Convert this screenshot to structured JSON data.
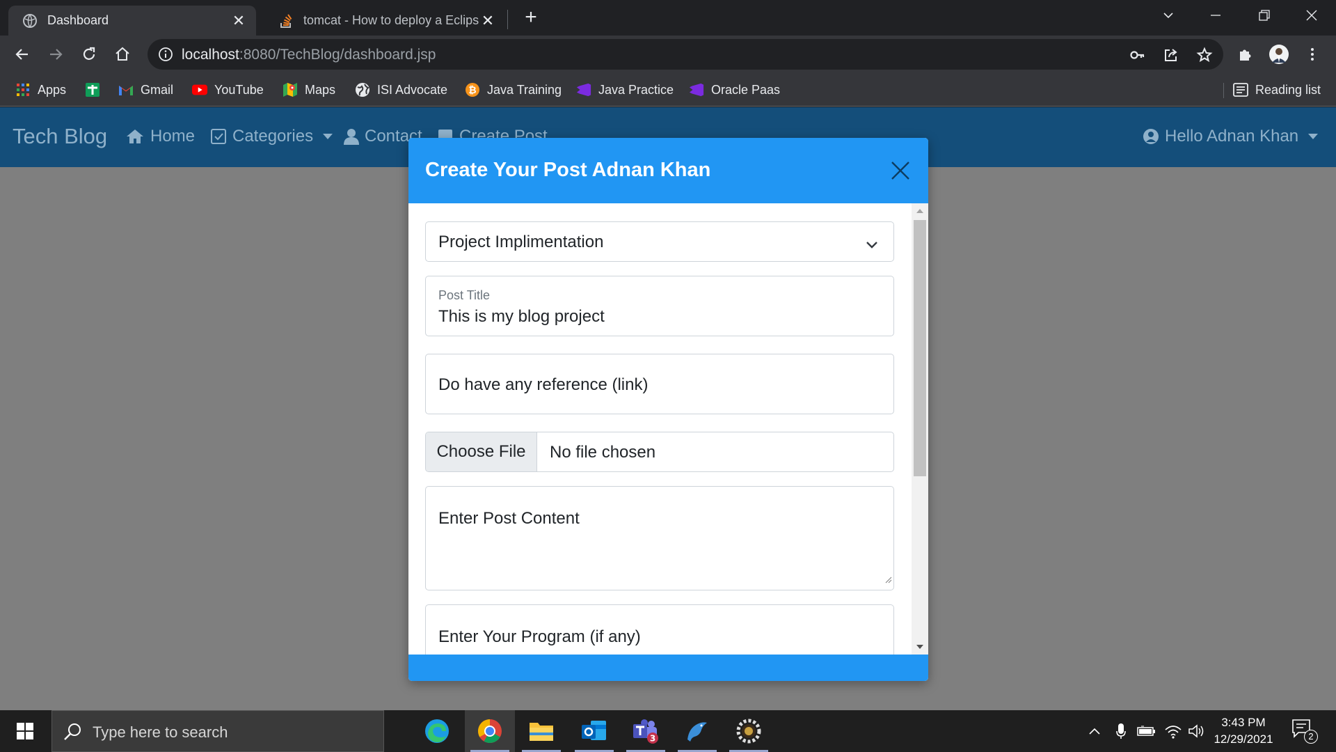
{
  "browser": {
    "tabs": [
      {
        "title": "Dashboard",
        "icon": "globe-icon",
        "active": true
      },
      {
        "title": "tomcat - How to deploy a Eclipse",
        "icon": "stackoverflow-icon",
        "active": false
      }
    ],
    "address": {
      "host": "localhost",
      "path": ":8080/TechBlog/dashboard.jsp"
    },
    "bookmarks": [
      {
        "label": "Apps",
        "icon": "apps-grid-icon"
      },
      {
        "label": "",
        "icon": "plus-square-icon"
      },
      {
        "label": "Gmail",
        "icon": "gmail-icon"
      },
      {
        "label": "YouTube",
        "icon": "youtube-icon"
      },
      {
        "label": "Maps",
        "icon": "maps-icon"
      },
      {
        "label": "ISI Advocate",
        "icon": "globe-icon"
      },
      {
        "label": "Java Training",
        "icon": "bitcoin-icon"
      },
      {
        "label": "Java Practice",
        "icon": "visual-studio-icon"
      },
      {
        "label": "Oracle Paas",
        "icon": "visual-studio-icon"
      }
    ],
    "reading_list": "Reading list"
  },
  "site": {
    "brand": "Tech Blog",
    "nav": {
      "home": "Home",
      "categories": "Categories",
      "contact": "Contact",
      "create_post": "Create Post",
      "user": "Hello Adnan Khan"
    }
  },
  "modal": {
    "title": "Create Your Post Adnan Khan",
    "category_selected": "Project Implimentation",
    "post_title_label": "Post Title",
    "post_title_value": "This is my blog project",
    "reference_placeholder": "Do have any reference (link)",
    "choose_file": "Choose File",
    "file_status": "No file chosen",
    "content_placeholder": "Enter Post Content",
    "program_placeholder": "Enter Your Program (if any)"
  },
  "taskbar": {
    "search_placeholder": "Type here to search",
    "time": "3:43 PM",
    "date": "12/29/2021",
    "teams_badge": "3",
    "notifications": "2"
  },
  "colors": {
    "modal_header": "#2196f3",
    "navbar": "#144e7a",
    "overlay": "#7f7f7f"
  }
}
